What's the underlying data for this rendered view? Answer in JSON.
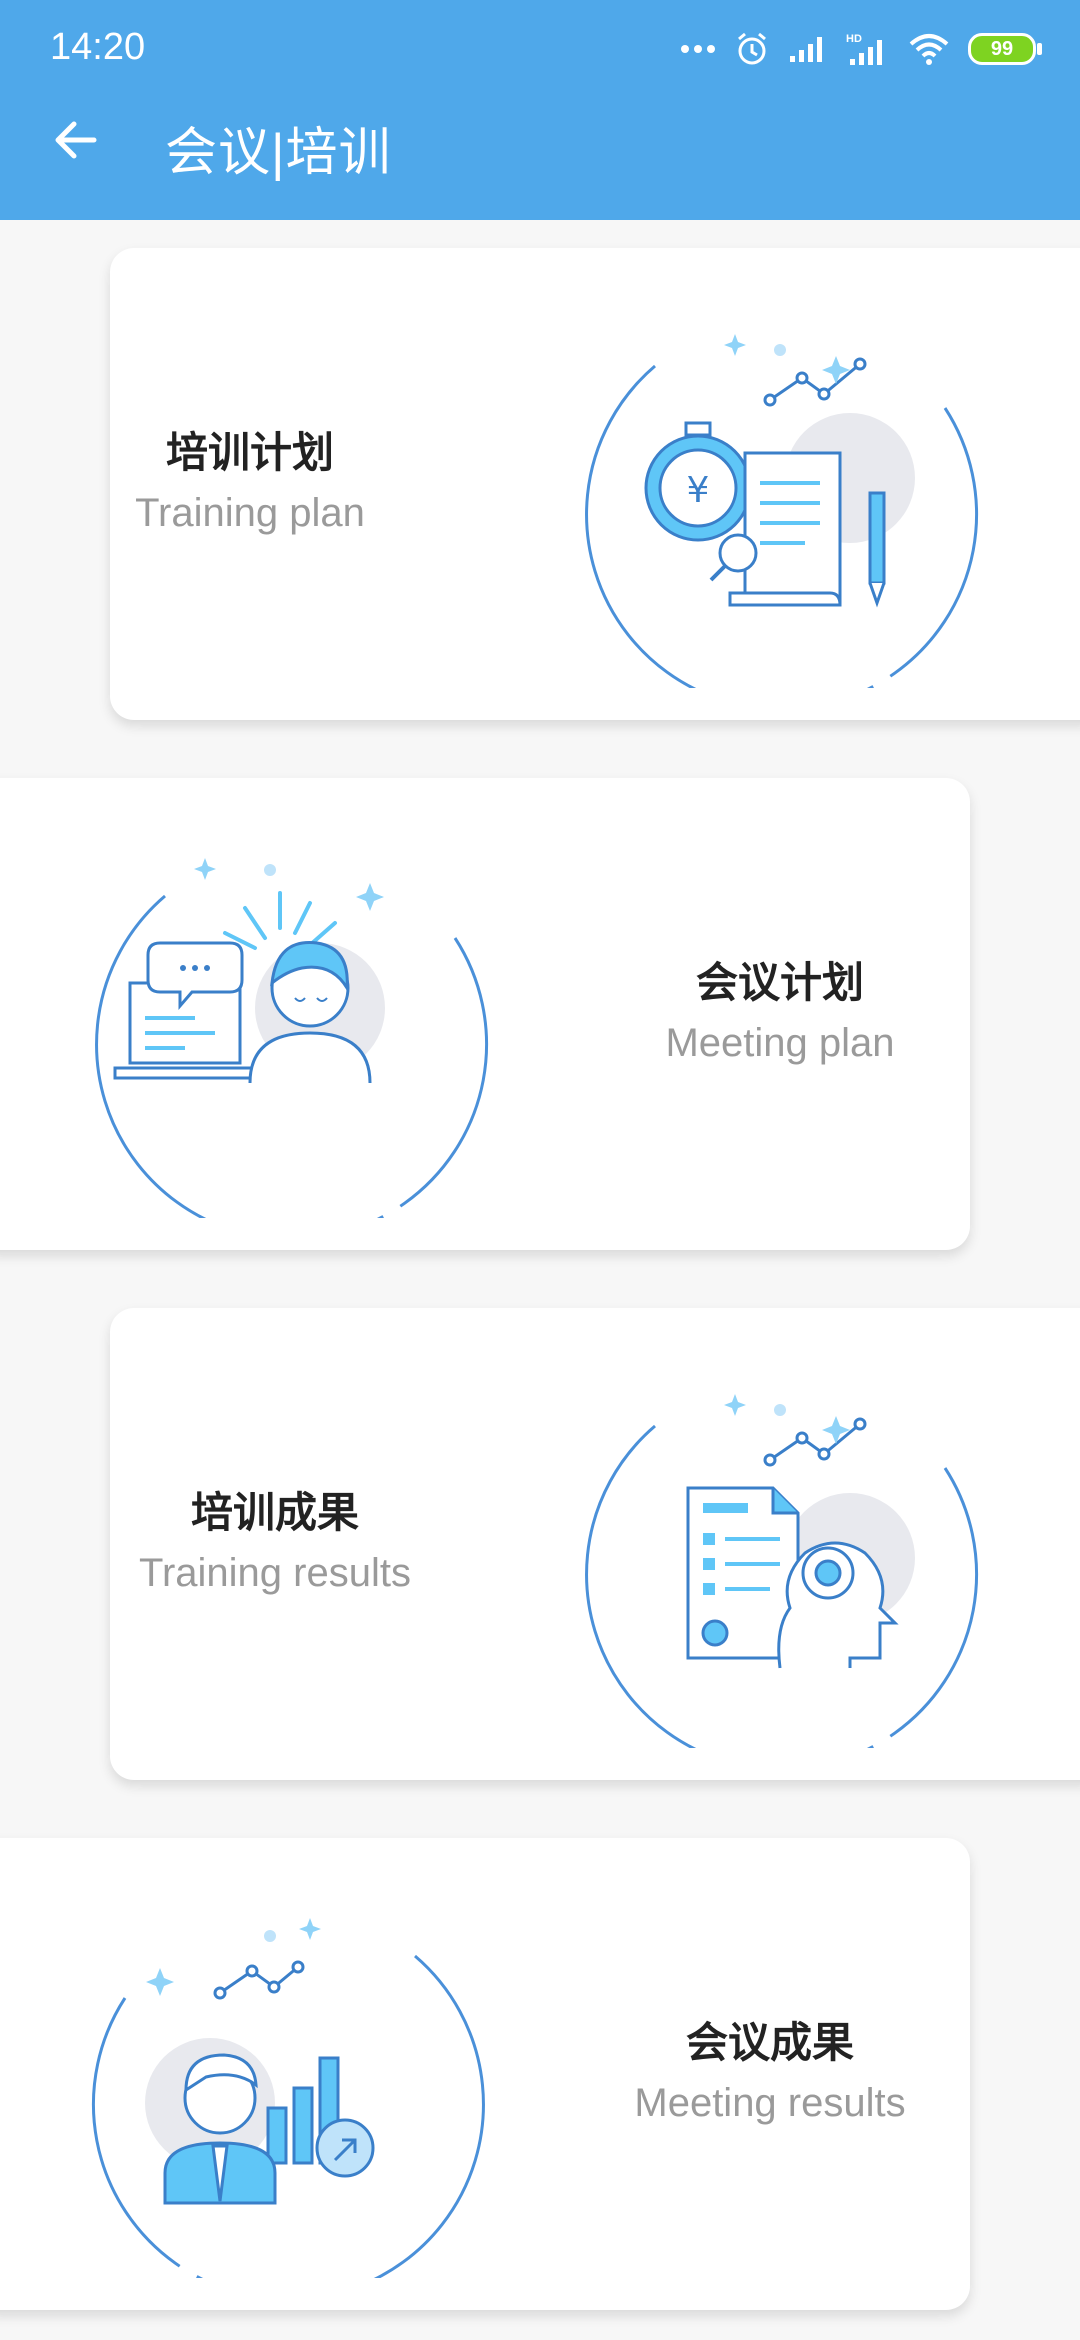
{
  "status_bar": {
    "time": "14:20",
    "battery": "99",
    "icons": [
      "more-dots-icon",
      "alarm-icon",
      "signal-icon",
      "hd-signal-icon",
      "wifi-icon",
      "battery-icon"
    ]
  },
  "header": {
    "title": "会议|培训",
    "back_icon": "arrow-left-icon"
  },
  "cards": [
    {
      "title_cn": "培训计划",
      "title_en": "Training plan",
      "icon": "training-plan-illustration"
    },
    {
      "title_cn": "会议计划",
      "title_en": "Meeting plan",
      "icon": "meeting-plan-illustration"
    },
    {
      "title_cn": "培训成果",
      "title_en": "Training results",
      "icon": "training-results-illustration"
    },
    {
      "title_cn": "会议成果",
      "title_en": "Meeting results",
      "icon": "meeting-results-illustration"
    }
  ],
  "colors": {
    "primary": "#4fa8ea",
    "accent_light": "#5fc6f7",
    "text_dark": "#222222",
    "text_gray": "#9a9a9a"
  }
}
